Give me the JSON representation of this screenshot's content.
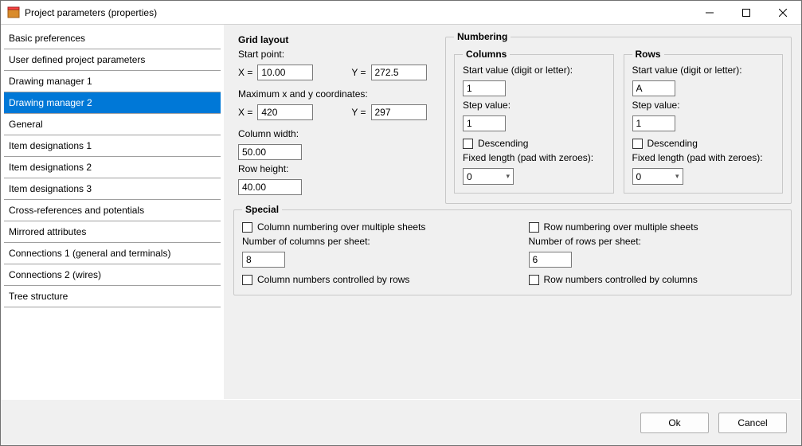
{
  "window": {
    "title": "Project parameters (properties)"
  },
  "sidebar": {
    "items": [
      {
        "label": "Basic preferences"
      },
      {
        "label": "User defined project parameters"
      },
      {
        "label": "Drawing manager 1"
      },
      {
        "label": "Drawing manager 2",
        "selected": true
      },
      {
        "label": "General"
      },
      {
        "label": "Item designations 1"
      },
      {
        "label": "Item designations 2"
      },
      {
        "label": "Item designations 3"
      },
      {
        "label": "Cross-references and potentials"
      },
      {
        "label": "Mirrored attributes"
      },
      {
        "label": "Connections 1 (general and terminals)"
      },
      {
        "label": "Connections 2 (wires)"
      },
      {
        "label": "Tree structure"
      }
    ]
  },
  "grid": {
    "title": "Grid layout",
    "start_label": "Start point:",
    "x_label": "X =",
    "y_label": "Y =",
    "start_x": "10.00",
    "start_y": "272.5",
    "max_label": "Maximum x and y coordinates:",
    "max_x": "420",
    "max_y": "297",
    "colw_label": "Column width:",
    "colw": "50.00",
    "rowh_label": "Row height:",
    "rowh": "40.00"
  },
  "numbering": {
    "title": "Numbering",
    "columns": {
      "title": "Columns",
      "start_label": "Start value (digit or letter):",
      "start": "1",
      "step_label": "Step value:",
      "step": "1",
      "desc_label": "Descending",
      "fixed_label": "Fixed length (pad with zeroes):",
      "fixed": "0"
    },
    "rows": {
      "title": "Rows",
      "start_label": "Start value (digit or letter):",
      "start": "A",
      "step_label": "Step value:",
      "step": "1",
      "desc_label": "Descending",
      "fixed_label": "Fixed length (pad with zeroes):",
      "fixed": "0"
    }
  },
  "special": {
    "title": "Special",
    "col_multi_label": "Column numbering over multiple sheets",
    "cols_per_label": "Number of columns per sheet:",
    "cols_per": "8",
    "col_by_rows_label": "Column numbers controlled by rows",
    "row_multi_label": "Row numbering over multiple sheets",
    "rows_per_label": "Number of rows per sheet:",
    "rows_per": "6",
    "row_by_cols_label": "Row numbers controlled by columns"
  },
  "footer": {
    "ok": "Ok",
    "cancel": "Cancel"
  }
}
